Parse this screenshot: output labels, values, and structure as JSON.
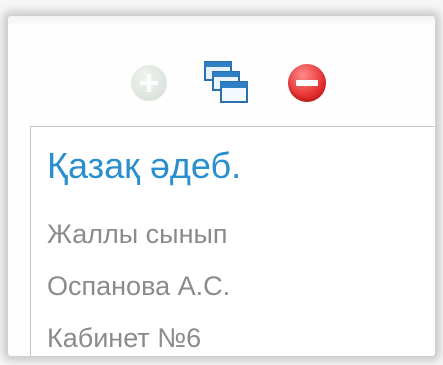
{
  "toolbar": {
    "add_icon": "add-circle-icon",
    "windows_icon": "windows-icon",
    "remove_icon": "remove-circle-icon"
  },
  "lesson": {
    "subject": "Қазақ әдеб.",
    "group": "Жаллы сынып",
    "teacher": "Оспанова А.С.",
    "room": "Кабинет №6"
  },
  "colors": {
    "subject": "#2a8fce",
    "details": "#8b8b8b",
    "remove": "#e53030"
  }
}
